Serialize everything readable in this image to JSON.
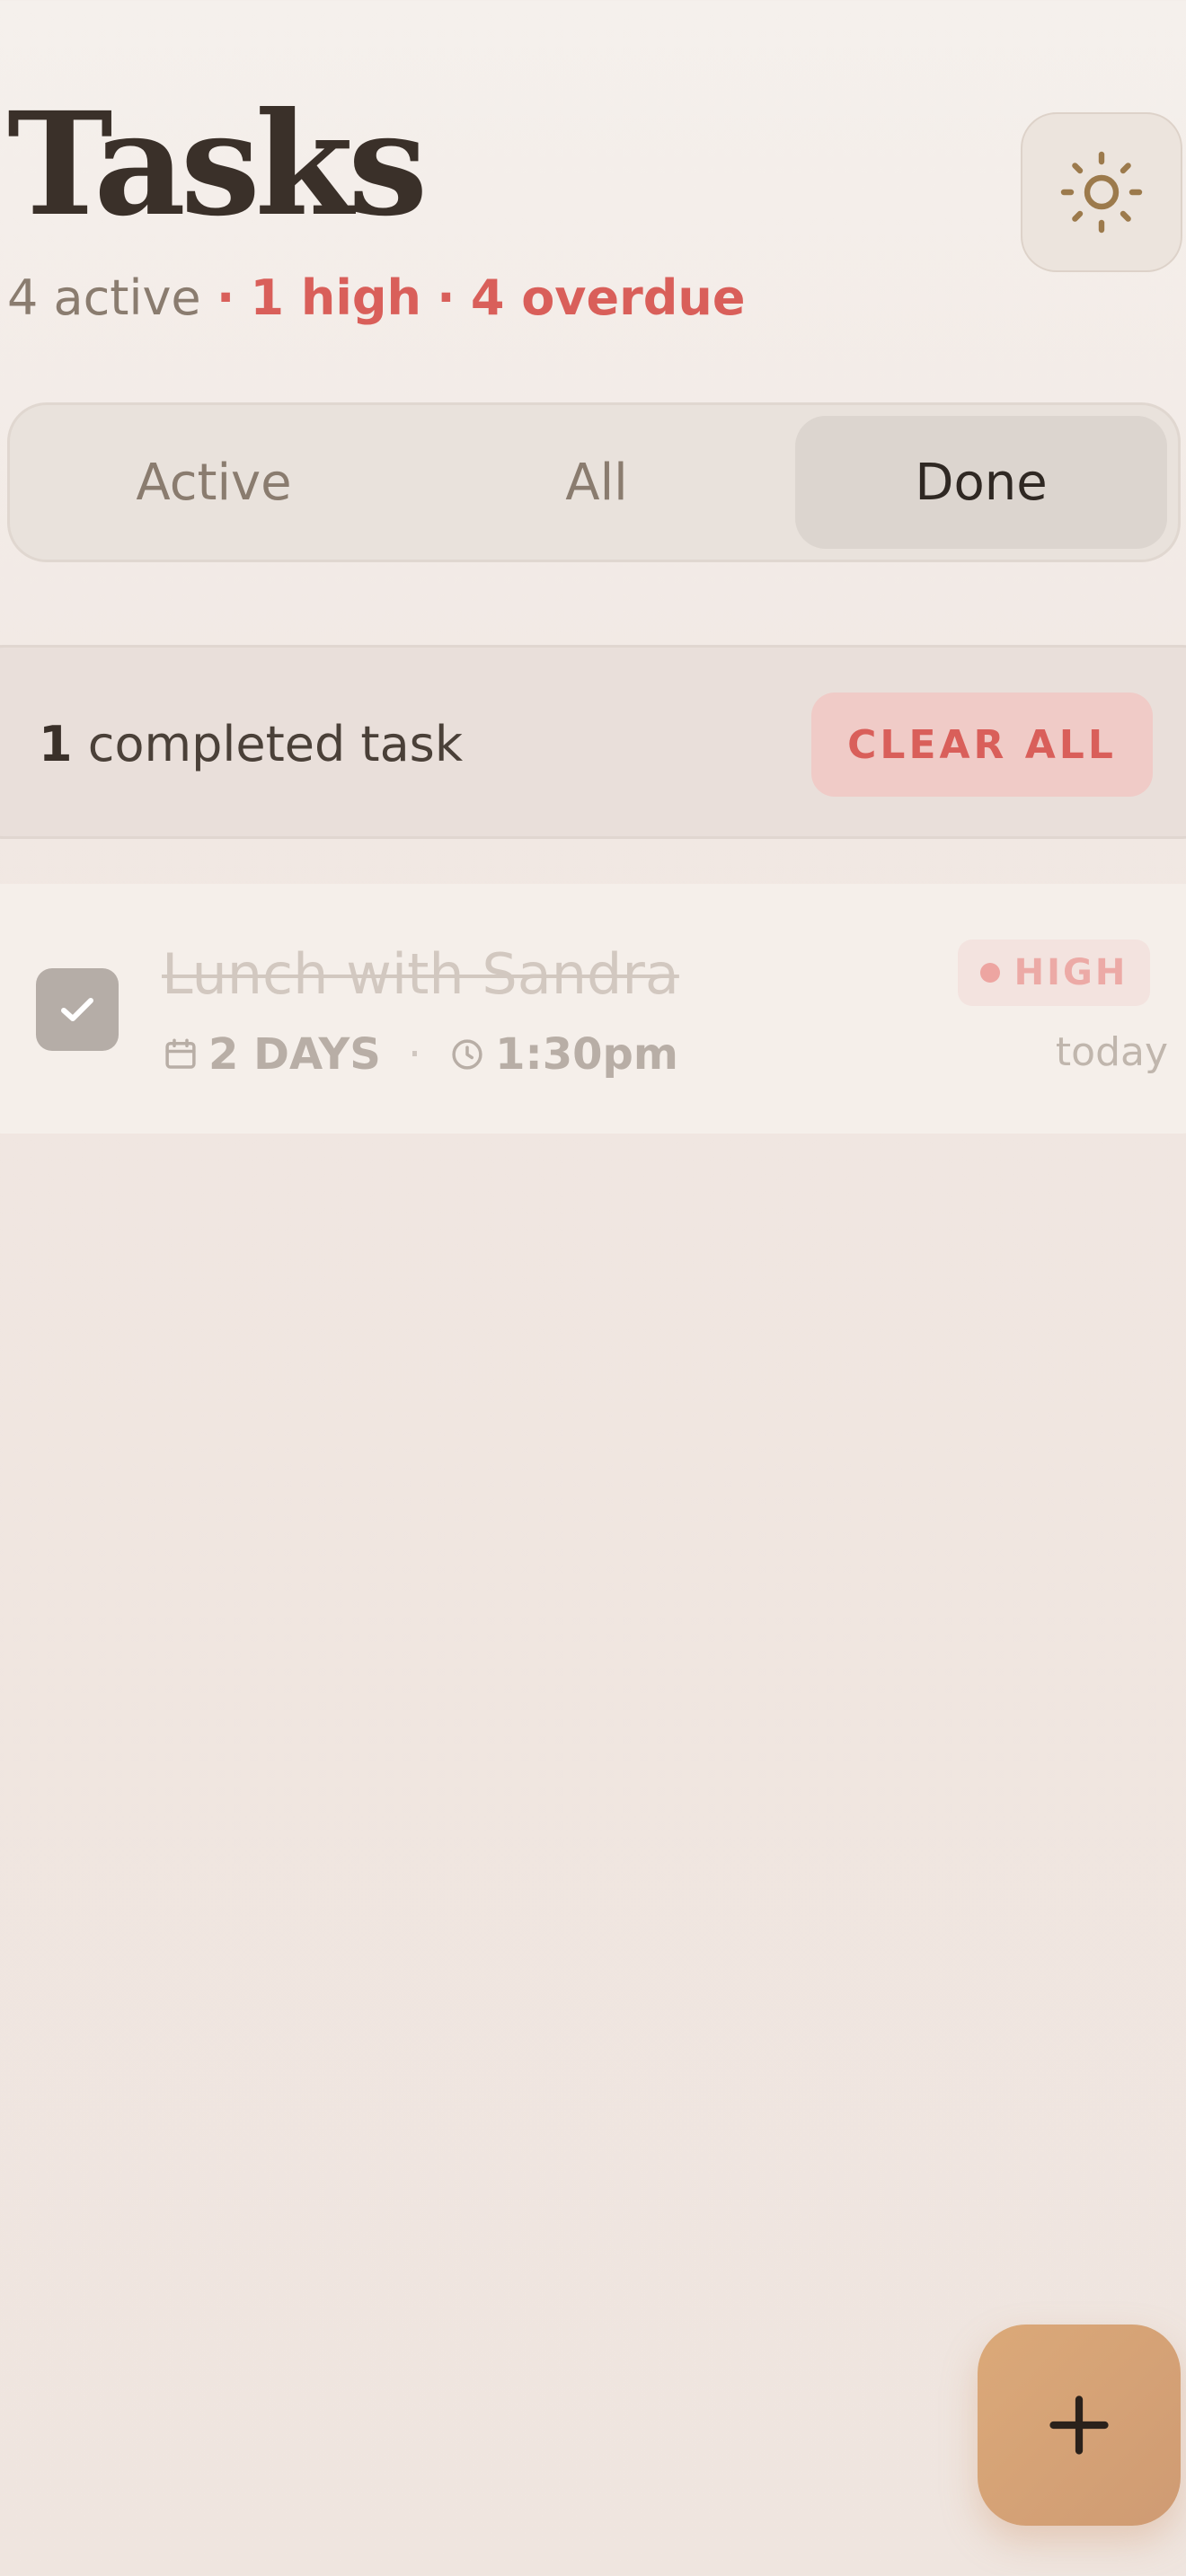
{
  "header": {
    "title": "Tasks",
    "summary": {
      "active": "4 active",
      "separator": "·",
      "high": "1 high",
      "overdue": "4 overdue"
    },
    "theme_icon": "sun-icon"
  },
  "filter_tabs": [
    {
      "label": "Active",
      "selected": false
    },
    {
      "label": "All",
      "selected": false
    },
    {
      "label": "Done",
      "selected": true
    }
  ],
  "completed_banner": {
    "count": "1",
    "label": "completed task",
    "clear_button": "CLEAR ALL"
  },
  "tasks": [
    {
      "title": "Lunch with Sandra",
      "completed": true,
      "date_label": "2 DAYS",
      "meta_separator": "·",
      "time": "1:30pm",
      "priority": "HIGH",
      "due": "today"
    }
  ],
  "fab": {
    "icon": "plus-icon"
  },
  "colors": {
    "accent": "#d95f5a",
    "fab": "#d4a074",
    "title": "#3a3029",
    "muted": "#8a7c6f"
  }
}
